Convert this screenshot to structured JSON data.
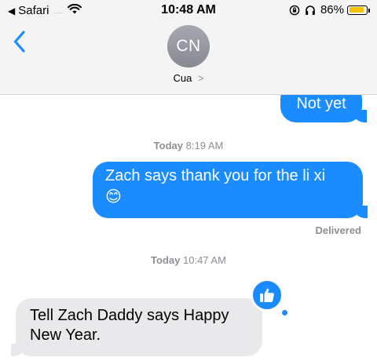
{
  "status_bar": {
    "back_app": "Safari",
    "signal_dots": "....",
    "time": "10:48 AM",
    "battery_percent": "86%",
    "battery_level": 0.86,
    "battery_color": "#f5c400"
  },
  "header": {
    "avatar_initials": "CN",
    "contact_name": "Cua",
    "name_chevron": ">"
  },
  "messages": [
    {
      "direction": "sent",
      "text": "Not yet"
    },
    {
      "type": "timestamp",
      "day": "Today",
      "time": "8:19 AM"
    },
    {
      "direction": "sent",
      "text": "Zach says thank you for the li xi",
      "emoji": "😊",
      "status": "Delivered"
    },
    {
      "type": "timestamp",
      "day": "Today",
      "time": "10:47 AM"
    },
    {
      "direction": "received",
      "text": "Tell Zach Daddy says Happy New Year.",
      "reaction": "thumbs-up-icon"
    }
  ],
  "colors": {
    "sent_bubble": "#1a8cff",
    "received_bubble": "#e9e9eb",
    "accent": "#1a8cff",
    "meta_text": "#8e8e93"
  }
}
